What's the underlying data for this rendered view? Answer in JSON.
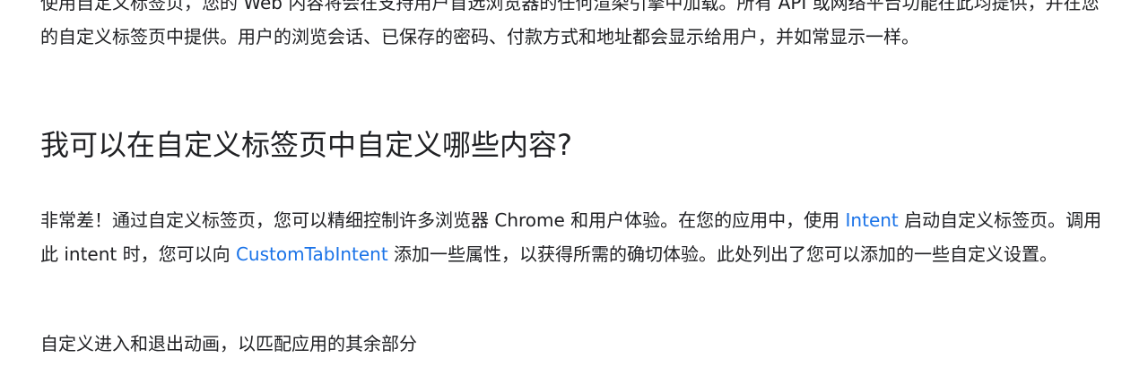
{
  "intro": {
    "text": "使用自定义标签页，您的 Web 内容将会在支持用户首选浏览器的任何渲染引擎中加载。所有 API 或网络平台功能在此均提供，并在您的自定义标签页中提供。用户的浏览会话、已保存的密码、付款方式和地址都会显示给用户，并如常显示一样。"
  },
  "section": {
    "heading": "我可以在自定义标签页中自定义哪些内容?",
    "body": {
      "part1": "非常差！通过自定义标签页，您可以精细控制许多浏览器 Chrome 和用户体验。在您的应用中，使用 ",
      "link1": "Intent",
      "part2": " 启动自定义标签页。调用此 intent 时，您可以向 ",
      "link2": "CustomTabIntent",
      "part3": " 添加一些属性，以获得所需的确切体验。此处列出了您可以添加的一些自定义设置。"
    },
    "list_item": "自定义进入和退出动画，以匹配应用的其余部分"
  },
  "colors": {
    "text": "#202124",
    "link": "#1a73e8"
  }
}
